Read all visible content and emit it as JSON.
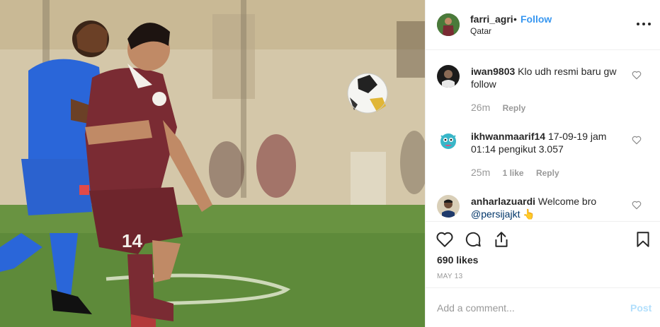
{
  "post": {
    "username": "farri_agri",
    "separator": "•",
    "follow_label": "Follow",
    "location": "Qatar",
    "image_alt": "Football match: player in maroon #14 shielding the ball from a player in blue",
    "jersey_number": "14"
  },
  "comments": [
    {
      "username": "iwan9803",
      "text": "Klo udh resmi baru gw follow",
      "time": "26m",
      "likes": "",
      "reply_label": "Reply"
    },
    {
      "username": "ikhwanmaarif14",
      "text": "17-09-19 jam 01:14 pengikut 3.057",
      "time": "25m",
      "likes": "1 like",
      "reply_label": "Reply"
    },
    {
      "username": "anharlazuardi",
      "text": "Welcome bro",
      "mention": "@persijajkt",
      "emoji": "👆"
    }
  ],
  "actions": {
    "like_icon": "heart-icon",
    "comment_icon": "comment-icon",
    "share_icon": "share-icon",
    "save_icon": "bookmark-icon",
    "likes_count": "690 likes",
    "date": "MAY 13"
  },
  "add_comment": {
    "placeholder": "Add a comment...",
    "post_label": "Post"
  },
  "colors": {
    "link_blue": "#3897f0",
    "post_disabled": "#b2dffc",
    "text": "#262626",
    "muted": "#999999",
    "divider": "#efefef",
    "maroon_kit": "#7a2b33",
    "blue_kit": "#2a66d9"
  }
}
